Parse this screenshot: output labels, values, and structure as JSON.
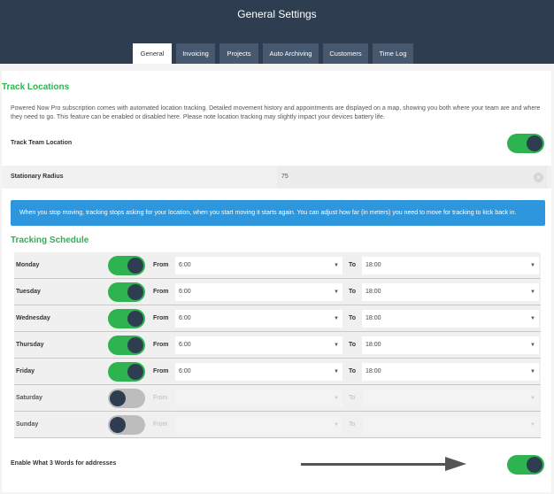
{
  "header": {
    "title": "General Settings"
  },
  "tabs": [
    {
      "label": "General",
      "active": true
    },
    {
      "label": "Invoicing",
      "active": false
    },
    {
      "label": "Projects",
      "active": false
    },
    {
      "label": "Auto Archiving",
      "active": false
    },
    {
      "label": "Customers",
      "active": false
    },
    {
      "label": "Time Log",
      "active": false
    }
  ],
  "track": {
    "title": "Track Locations",
    "description": "Powered Now Pro subscription comes with automated location tracking. Detailed movement history and appointments are displayed on a map, showing you both where your team are and where they need to go. This feature can be enabled or disabled here. Please note location tracking may slightly impact your devices battery life.",
    "team_location_label": "Track Team Location",
    "team_location_on": true,
    "radius_label": "Stationary Radius",
    "radius_value": "75",
    "info": "When you stop moving, tracking stops asking for your location, when you start moving it starts again. You can adjust how far (in meters) you need to move for tracking to kick back in."
  },
  "schedule": {
    "title": "Tracking Schedule",
    "from_label": "From",
    "to_label": "To",
    "days": [
      {
        "day": "Monday",
        "enabled": true,
        "from": "6:00",
        "to": "18:00"
      },
      {
        "day": "Tuesday",
        "enabled": true,
        "from": "6:00",
        "to": "18:00"
      },
      {
        "day": "Wednesday",
        "enabled": true,
        "from": "6:00",
        "to": "18:00"
      },
      {
        "day": "Thursday",
        "enabled": true,
        "from": "6:00",
        "to": "18:00"
      },
      {
        "day": "Friday",
        "enabled": true,
        "from": "6:00",
        "to": "18:00"
      },
      {
        "day": "Saturday",
        "enabled": false,
        "from": "",
        "to": ""
      },
      {
        "day": "Sunday",
        "enabled": false,
        "from": "",
        "to": ""
      }
    ]
  },
  "what3words": {
    "label": "Enable What 3 Words for addresses",
    "on": true
  },
  "colors": {
    "header": "#2e3e50",
    "green": "#2db350",
    "info": "#2e96dc",
    "knob": "#2e3e50"
  },
  "icons": {
    "clear": "clear-icon",
    "dropdown": "chevron-down-icon",
    "annotation": "arrow-right-icon"
  }
}
